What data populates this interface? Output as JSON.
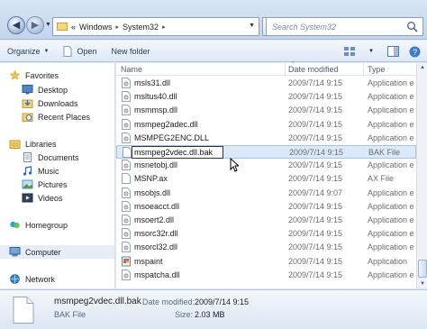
{
  "address_bar": {
    "prefix": "«",
    "crumbs": [
      "Windows",
      "System32"
    ],
    "separator": "▸",
    "search_placeholder": "Search System32"
  },
  "toolbar": {
    "organize_label": "Organize",
    "open_label": "Open",
    "new_folder_label": "New folder"
  },
  "nav": {
    "favorites": "Favorites",
    "desktop": "Desktop",
    "downloads": "Downloads",
    "recent_places": "Recent Places",
    "libraries": "Libraries",
    "documents": "Documents",
    "music": "Music",
    "pictures": "Pictures",
    "videos": "Videos",
    "homegroup": "Homegroup",
    "computer": "Computer",
    "network": "Network"
  },
  "columns": {
    "name": "Name",
    "date_modified": "Date modified",
    "type": "Type"
  },
  "files": [
    {
      "name": "msls31.dll",
      "date": "2009/7/14 9:15",
      "type": "Application e"
    },
    {
      "name": "msltus40.dll",
      "date": "2009/7/14 9:15",
      "type": "Application e"
    },
    {
      "name": "msmmsp.dll",
      "date": "2009/7/14 9:15",
      "type": "Application e"
    },
    {
      "name": "msmpeg2adec.dll",
      "date": "2009/7/14 9:15",
      "type": "Application e"
    },
    {
      "name": "MSMPEG2ENC.DLL",
      "date": "2009/7/14 9:15",
      "type": "Application e"
    },
    {
      "name": "msmpeg2vdec.dll.bak",
      "date": "2009/7/14 9:15",
      "type": "BAK File"
    },
    {
      "name": "msnetobj.dll",
      "date": "2009/7/14 9:15",
      "type": "Application e"
    },
    {
      "name": "MSNP.ax",
      "date": "2009/7/14 9:15",
      "type": "AX File"
    },
    {
      "name": "msobjs.dll",
      "date": "2009/7/14 9:07",
      "type": "Application e"
    },
    {
      "name": "msoeacct.dll",
      "date": "2009/7/14 9:15",
      "type": "Application e"
    },
    {
      "name": "msoert2.dll",
      "date": "2009/7/14 9:15",
      "type": "Application e"
    },
    {
      "name": "msorc32r.dll",
      "date": "2009/7/14 9:15",
      "type": "Application e"
    },
    {
      "name": "msorcl32.dll",
      "date": "2009/7/14 9:15",
      "type": "Application e"
    },
    {
      "name": "mspaint",
      "date": "2009/7/14 9:15",
      "type": "Application"
    },
    {
      "name": "mspatcha.dll",
      "date": "2009/7/14 9:15",
      "type": "Application e"
    }
  ],
  "rename_value": "msmpeg2vdec.dll.bak",
  "details": {
    "name": "msmpeg2vdec.dll.bak",
    "type": "BAK File",
    "date_label": "Date modified:",
    "date_value": "2009/7/14 9:15",
    "size_label": "Size:",
    "size_value": "2.03 MB"
  }
}
